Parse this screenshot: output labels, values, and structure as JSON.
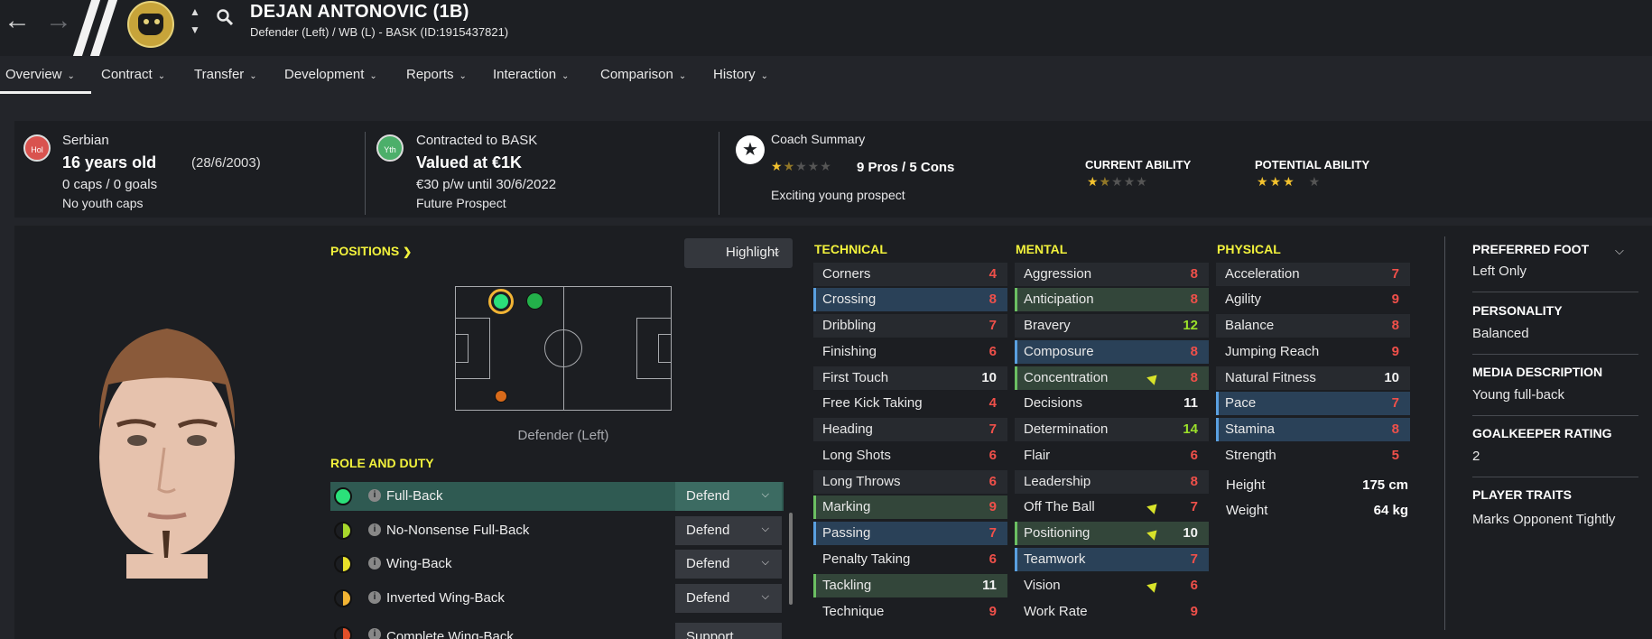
{
  "header": {
    "player_name": "DEJAN ANTONOVIC (1B)",
    "subtitle": "Defender (Left) / WB (L) - BASK (ID:1915437821)"
  },
  "tabs": [
    {
      "label": "Overview"
    },
    {
      "label": "Contract"
    },
    {
      "label": "Transfer"
    },
    {
      "label": "Development"
    },
    {
      "label": "Reports"
    },
    {
      "label": "Interaction"
    },
    {
      "label": "Comparison"
    },
    {
      "label": "History"
    }
  ],
  "info": {
    "nation_badge": "Hol",
    "nationality": "Serbian",
    "age": "16 years old",
    "dob": "(28/6/2003)",
    "caps": "0 caps / 0 goals",
    "youth_caps": "No youth caps",
    "youth_badge": "Yth",
    "contract": "Contracted to BASK",
    "value": "Valued at €1K",
    "wage": "€30 p/w until 30/6/2022",
    "status": "Future Prospect",
    "coach_title": "Coach Summary",
    "pros_cons": "9 Pros / 5 Cons",
    "coach_comment": "Exciting young prospect",
    "coach_stars": 1.5,
    "current_ability_label": "CURRENT ABILITY",
    "current_ability_stars": 1.5,
    "potential_ability_label": "POTENTIAL ABILITY",
    "potential_ability_stars": 3
  },
  "positions": {
    "title": "POSITIONS",
    "highlight_label": "Highlight",
    "position_label": "Defender (Left)"
  },
  "roles": {
    "title": "ROLE AND DUTY",
    "items": [
      {
        "name": "Full-Back",
        "duty": "Defend",
        "color": "#2be07a"
      },
      {
        "name": "No-Nonsense Full-Back",
        "duty": "Defend",
        "color": "#a8d82c"
      },
      {
        "name": "Wing-Back",
        "duty": "Defend",
        "color": "#e8e02a"
      },
      {
        "name": "Inverted Wing-Back",
        "duty": "Defend",
        "color": "#f2b434"
      },
      {
        "name": "Complete Wing-Back",
        "duty": "Support",
        "color": "#e0502a"
      }
    ]
  },
  "technical": {
    "title": "TECHNICAL",
    "items": [
      {
        "name": "Corners",
        "value": "4"
      },
      {
        "name": "Crossing",
        "value": "8"
      },
      {
        "name": "Dribbling",
        "value": "7"
      },
      {
        "name": "Finishing",
        "value": "6"
      },
      {
        "name": "First Touch",
        "value": "10"
      },
      {
        "name": "Free Kick Taking",
        "value": "4"
      },
      {
        "name": "Heading",
        "value": "7"
      },
      {
        "name": "Long Shots",
        "value": "6"
      },
      {
        "name": "Long Throws",
        "value": "6"
      },
      {
        "name": "Marking",
        "value": "9"
      },
      {
        "name": "Passing",
        "value": "7"
      },
      {
        "name": "Penalty Taking",
        "value": "6"
      },
      {
        "name": "Tackling",
        "value": "11"
      },
      {
        "name": "Technique",
        "value": "9"
      }
    ]
  },
  "mental": {
    "title": "MENTAL",
    "items": [
      {
        "name": "Aggression",
        "value": "8"
      },
      {
        "name": "Anticipation",
        "value": "8"
      },
      {
        "name": "Bravery",
        "value": "12"
      },
      {
        "name": "Composure",
        "value": "8"
      },
      {
        "name": "Concentration",
        "value": "8"
      },
      {
        "name": "Decisions",
        "value": "11"
      },
      {
        "name": "Determination",
        "value": "14"
      },
      {
        "name": "Flair",
        "value": "6"
      },
      {
        "name": "Leadership",
        "value": "8"
      },
      {
        "name": "Off The Ball",
        "value": "7"
      },
      {
        "name": "Positioning",
        "value": "10"
      },
      {
        "name": "Teamwork",
        "value": "7"
      },
      {
        "name": "Vision",
        "value": "6"
      },
      {
        "name": "Work Rate",
        "value": "9"
      }
    ]
  },
  "physical": {
    "title": "PHYSICAL",
    "items": [
      {
        "name": "Acceleration",
        "value": "7"
      },
      {
        "name": "Agility",
        "value": "9"
      },
      {
        "name": "Balance",
        "value": "8"
      },
      {
        "name": "Jumping Reach",
        "value": "9"
      },
      {
        "name": "Natural Fitness",
        "value": "10"
      },
      {
        "name": "Pace",
        "value": "7"
      },
      {
        "name": "Stamina",
        "value": "8"
      },
      {
        "name": "Strength",
        "value": "5"
      }
    ],
    "height_label": "Height",
    "height": "175 cm",
    "weight_label": "Weight",
    "weight": "64 kg"
  },
  "side": {
    "foot_title": "PREFERRED FOOT",
    "foot": "Left Only",
    "personality_title": "PERSONALITY",
    "personality": "Balanced",
    "media_title": "MEDIA DESCRIPTION",
    "media": "Young full-back",
    "gk_title": "GOALKEEPER RATING",
    "gk": "2",
    "traits_title": "PLAYER TRAITS",
    "traits": "Marks Opponent Tightly"
  },
  "colors": {
    "accent_yellow": "#f2f23c",
    "low_value": "#f0504a",
    "high_value": "#9be02a",
    "star": "#f2c12e"
  }
}
